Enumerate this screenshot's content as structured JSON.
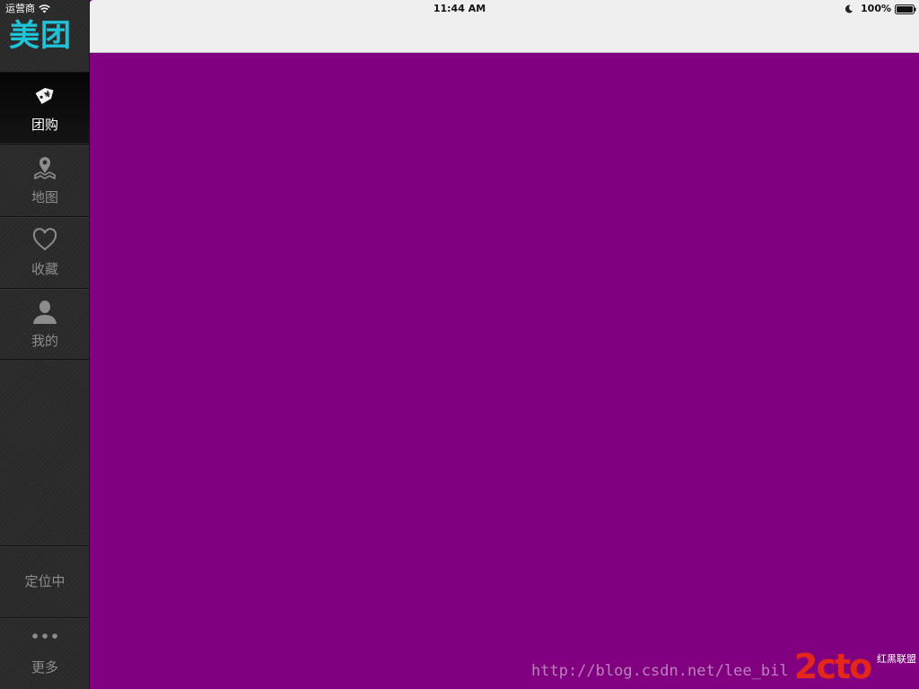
{
  "status_bar": {
    "carrier": "运营商",
    "time": "11:44 AM",
    "battery": "100%"
  },
  "brand": {
    "logo_text": "美团",
    "color": "#1fc2d6"
  },
  "sidebar": {
    "items": [
      {
        "label": "团购",
        "icon": "tag-icon",
        "active": true
      },
      {
        "label": "地图",
        "icon": "map-pin-icon",
        "active": false
      },
      {
        "label": "收藏",
        "icon": "heart-icon",
        "active": false
      },
      {
        "label": "我的",
        "icon": "user-icon",
        "active": false
      }
    ],
    "locating": "定位中",
    "more": {
      "label": "更多",
      "icon": "more-dots-icon"
    }
  },
  "main": {
    "background_color": "#800080"
  },
  "watermark": {
    "url": "http://blog.csdn.net/lee_bil",
    "site_logo": "2cto",
    "site_sub": "红黑联盟"
  }
}
